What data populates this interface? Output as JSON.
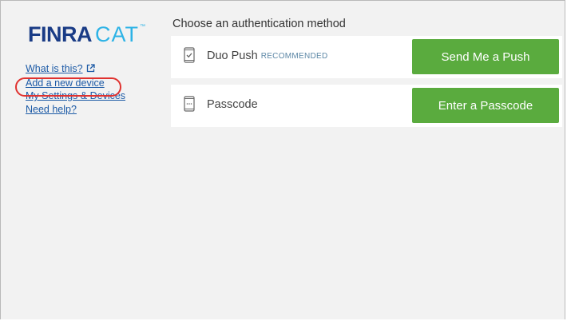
{
  "sidebar": {
    "logo": {
      "brand_primary": "FINRA",
      "brand_secondary": "CAT",
      "trademark": "™",
      "primary_color": "#1a3c86",
      "secondary_color": "#2db3e6"
    },
    "links": {
      "what_is_this": "What is this?",
      "add_device": "Add a new device",
      "settings": "My Settings & Devices",
      "help": "Need help?"
    },
    "highlight_color": "#e0322f"
  },
  "main": {
    "title": "Choose an authentication method",
    "methods": [
      {
        "label": "Duo Push",
        "badge": "RECOMMENDED",
        "icon": "phone-check-icon",
        "button_label": "Send Me a Push"
      },
      {
        "label": "Passcode",
        "badge": "",
        "icon": "phone-keypad-icon",
        "button_label": "Enter a Passcode"
      }
    ],
    "button_color": "#5aab3e"
  }
}
